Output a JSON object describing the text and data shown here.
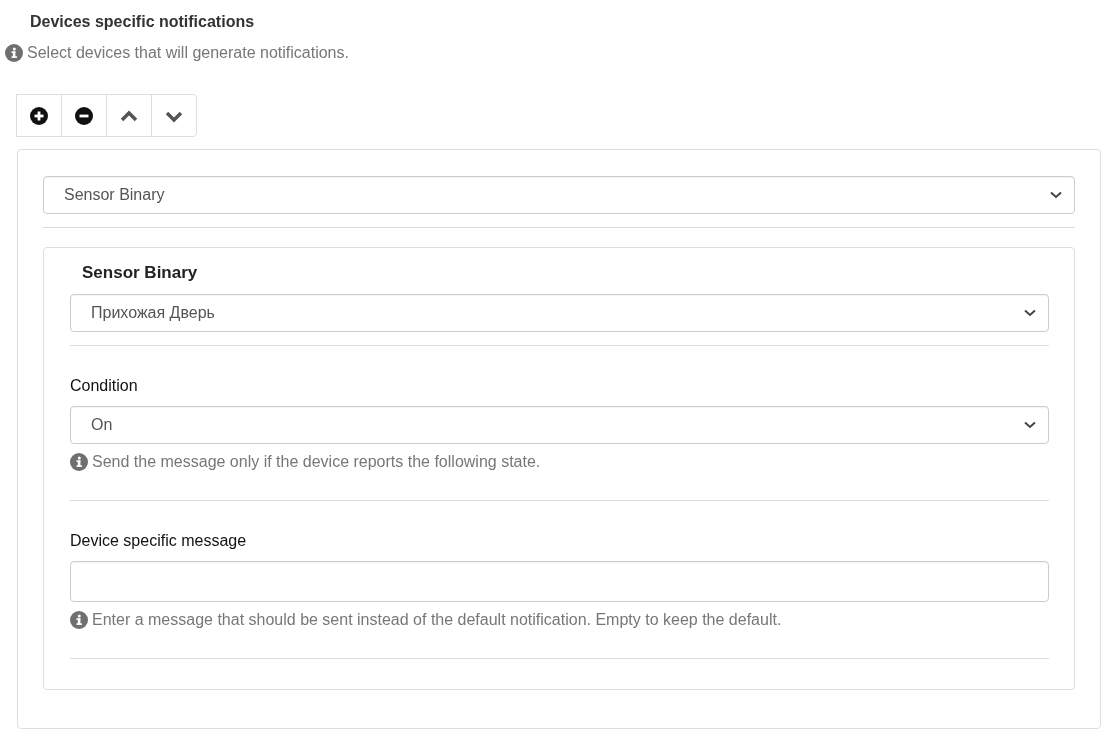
{
  "section": {
    "title": "Devices specific notifications",
    "help": "Select devices that will generate notifications."
  },
  "toolbar": [
    {
      "kind": "add"
    },
    {
      "kind": "remove"
    },
    {
      "kind": "up"
    },
    {
      "kind": "down"
    }
  ],
  "device_type_select": {
    "value": "Sensor Binary"
  },
  "device": {
    "title": "Sensor Binary",
    "fields": [
      {
        "kind": "select",
        "value": "Прихожая Дверь"
      },
      {
        "kind": "select",
        "label": "Condition",
        "value": "On",
        "help": "Send the message only if the device reports the following state."
      },
      {
        "kind": "text",
        "label": "Device specific message",
        "help": "Enter a message that should be sent instead of the default notification. Empty to keep the default."
      }
    ]
  }
}
